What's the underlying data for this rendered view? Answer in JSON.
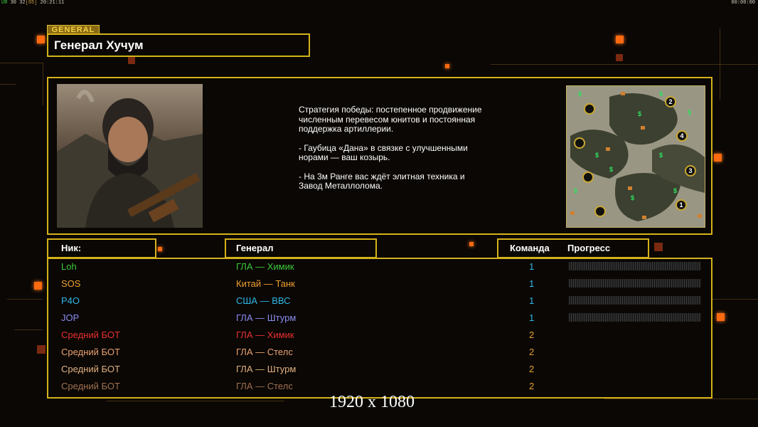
{
  "hud": {
    "left_prefix": "UR",
    "left_vals": "30 32",
    "left_bracket": "[65]",
    "left_time": "20:21:11",
    "right_time": "00:00:00"
  },
  "general": {
    "tag": "GENERAL",
    "name": "Генерал Хучум"
  },
  "description": [
    "Стратегия победы: постепенное продвижение численным перевесом юнитов и постоянная поддержка артиллерии.",
    "- Гаубица «Дана» в связке с улучшенными норами — ваш козырь.",
    "- На 3м Ранге вас ждёт элитная техника и Завод Металлолома."
  ],
  "headers": {
    "nick": "Ник:",
    "general": "Генерал",
    "team": "Команда",
    "progress": "Прогресс"
  },
  "players": [
    {
      "nick": "Loh",
      "general": "ГЛА — Химик",
      "team": "1",
      "color": "#3cc83c"
    },
    {
      "nick": "SOS",
      "general": "Китай — Танк",
      "team": "1",
      "color": "#f0a030"
    },
    {
      "nick": "P4O",
      "general": "США — ВВС",
      "team": "1",
      "color": "#30b8e8"
    },
    {
      "nick": "JOP",
      "general": "ГЛА — Штурм",
      "team": "1",
      "color": "#8c8cf0"
    },
    {
      "nick": "Средний БОТ",
      "general": "ГЛА — Химик",
      "team": "2",
      "color": "#e83030"
    },
    {
      "nick": "Средний БОТ",
      "general": "ГЛА — Стелс",
      "team": "2",
      "color": "#e8a070"
    },
    {
      "nick": "Средний БОТ",
      "general": "ГЛА — Штурм",
      "team": "2",
      "color": "#e0b080"
    },
    {
      "nick": "Средний БОТ",
      "general": "ГЛА — Стелс",
      "team": "2",
      "color": "#a07050"
    }
  ],
  "team_colors": {
    "1": "#30b8e8",
    "2": "#e8a030"
  },
  "map_markers": [
    "2",
    "4",
    "3",
    "1"
  ],
  "resolution": "1920 x 1080"
}
